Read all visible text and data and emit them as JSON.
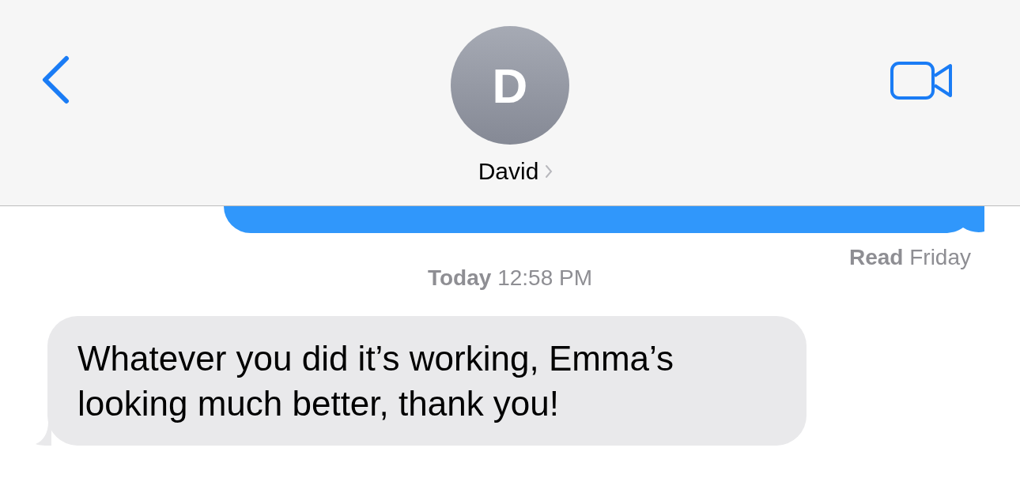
{
  "header": {
    "avatar_initial": "D",
    "contact_name": "David"
  },
  "messages": [
    {
      "kind": "sent"
    },
    {
      "kind": "receipt",
      "text": "**Read** Friday"
    },
    {
      "kind": "timestamp",
      "text": "**Today** 12:58 PM"
    },
    {
      "kind": "received",
      "text": "Whatever you did it’s working, Emma’s looking much better, thank you!"
    }
  ]
}
